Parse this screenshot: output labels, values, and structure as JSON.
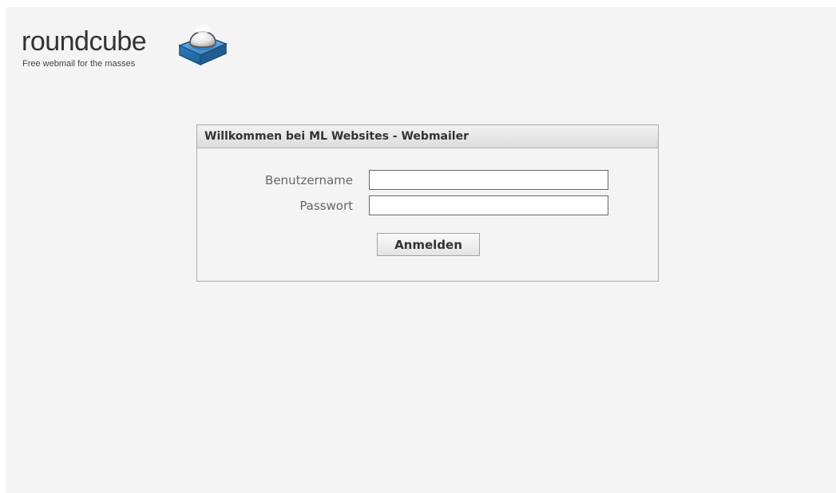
{
  "logo": {
    "wordmark": "roundcube",
    "tagline": "Free webmail for the masses",
    "icon": "roundcube-cube-icon"
  },
  "login": {
    "title": "Willkommen bei ML Websites - Webmailer",
    "username_label": "Benutzername",
    "username_value": "",
    "password_label": "Passwort",
    "password_value": "",
    "submit_label": "Anmelden"
  },
  "colors": {
    "page_background": "#f4f4f4",
    "cube_blue": "#2f7fc1",
    "header_gradient_top": "#f2f2f2",
    "header_gradient_bottom": "#dcdcdc"
  }
}
